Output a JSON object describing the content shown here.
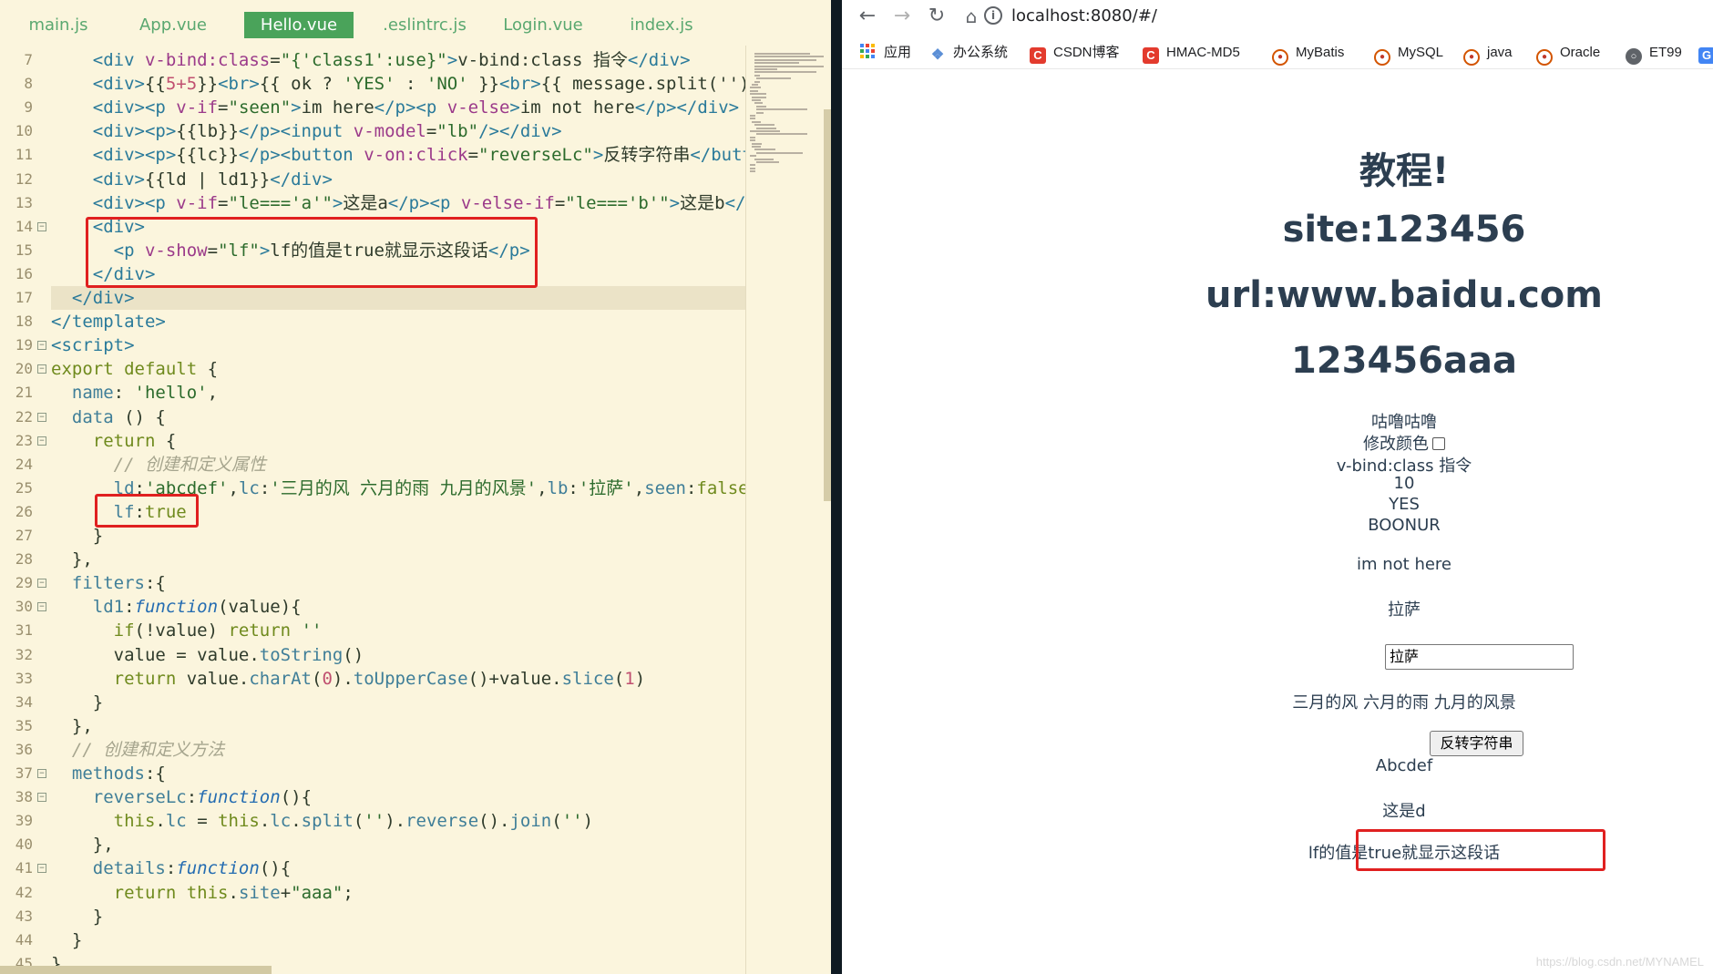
{
  "editor": {
    "tabs": [
      {
        "label": "main.js",
        "active": false
      },
      {
        "label": "App.vue",
        "active": false
      },
      {
        "label": "Hello.vue",
        "active": true
      },
      {
        "label": ".eslintrc.js",
        "active": false
      },
      {
        "label": "Login.vue",
        "active": false
      },
      {
        "label": "index.js",
        "active": false
      }
    ],
    "lines": [
      {
        "n": "7",
        "fold": false,
        "cur": false,
        "tokens": [
          [
            "plain",
            "    "
          ],
          [
            "tag",
            "<div "
          ],
          [
            "attr",
            "v-bind:class"
          ],
          [
            "plain",
            "="
          ],
          [
            "str",
            "\"{'class1':use}\""
          ],
          [
            "tag",
            ">"
          ],
          [
            "plain",
            "v-bind:class 指令"
          ],
          [
            "tag",
            "</div>"
          ]
        ]
      },
      {
        "n": "8",
        "fold": false,
        "cur": false,
        "tokens": [
          [
            "plain",
            "    "
          ],
          [
            "tag",
            "<div>"
          ],
          [
            "plain",
            "{{"
          ],
          [
            "num",
            "5+5"
          ],
          [
            "plain",
            "}}"
          ],
          [
            "tag",
            "<br>"
          ],
          [
            "plain",
            "{{ ok ? "
          ],
          [
            "str",
            "'YES'"
          ],
          [
            "plain",
            " : "
          ],
          [
            "str",
            "'NO'"
          ],
          [
            "plain",
            " }}"
          ],
          [
            "tag",
            "<br>"
          ],
          [
            "plain",
            "{{ message.split(''"
          ],
          [
            "plain",
            ").reverse()"
          ]
        ]
      },
      {
        "n": "9",
        "fold": false,
        "cur": false,
        "tokens": [
          [
            "plain",
            "    "
          ],
          [
            "tag",
            "<div><p "
          ],
          [
            "attr",
            "v-if"
          ],
          [
            "plain",
            "="
          ],
          [
            "str",
            "\"seen\""
          ],
          [
            "tag",
            ">"
          ],
          [
            "plain",
            "im here"
          ],
          [
            "tag",
            "</p><p "
          ],
          [
            "attr",
            "v-else"
          ],
          [
            "tag",
            ">"
          ],
          [
            "plain",
            "im not here"
          ],
          [
            "tag",
            "</p></div>"
          ]
        ]
      },
      {
        "n": "10",
        "fold": false,
        "cur": false,
        "tokens": [
          [
            "plain",
            "    "
          ],
          [
            "tag",
            "<div><p>"
          ],
          [
            "plain",
            "{{lb}}"
          ],
          [
            "tag",
            "</p><input "
          ],
          [
            "attr",
            "v-model"
          ],
          [
            "plain",
            "="
          ],
          [
            "str",
            "\"lb\""
          ],
          [
            "tag",
            "/></div>"
          ]
        ]
      },
      {
        "n": "11",
        "fold": false,
        "cur": false,
        "tokens": [
          [
            "plain",
            "    "
          ],
          [
            "tag",
            "<div><p>"
          ],
          [
            "plain",
            "{{lc}}"
          ],
          [
            "tag",
            "</p><button "
          ],
          [
            "attr",
            "v-on:click"
          ],
          [
            "plain",
            "="
          ],
          [
            "str",
            "\"reverseLc\""
          ],
          [
            "tag",
            ">"
          ],
          [
            "plain",
            "反转字符串"
          ],
          [
            "tag",
            "</button></div>"
          ]
        ]
      },
      {
        "n": "12",
        "fold": false,
        "cur": false,
        "tokens": [
          [
            "plain",
            "    "
          ],
          [
            "tag",
            "<div>"
          ],
          [
            "plain",
            "{{ld | ld1}}"
          ],
          [
            "tag",
            "</div>"
          ]
        ]
      },
      {
        "n": "13",
        "fold": false,
        "cur": false,
        "tokens": [
          [
            "plain",
            "    "
          ],
          [
            "tag",
            "<div><p "
          ],
          [
            "attr",
            "v-if"
          ],
          [
            "plain",
            "="
          ],
          [
            "str",
            "\"le==='a'\""
          ],
          [
            "tag",
            ">"
          ],
          [
            "plain",
            "这是a"
          ],
          [
            "tag",
            "</p><p "
          ],
          [
            "attr",
            "v-else-if"
          ],
          [
            "plain",
            "="
          ],
          [
            "str",
            "\"le==='b'\""
          ],
          [
            "tag",
            ">"
          ],
          [
            "plain",
            "这是b"
          ],
          [
            "tag",
            "</p>"
          ]
        ]
      },
      {
        "n": "14",
        "fold": true,
        "cur": false,
        "tokens": [
          [
            "plain",
            "    "
          ],
          [
            "tag",
            "<div>"
          ]
        ]
      },
      {
        "n": "15",
        "fold": false,
        "cur": false,
        "tokens": [
          [
            "plain",
            "      "
          ],
          [
            "tag",
            "<p "
          ],
          [
            "attr",
            "v-show"
          ],
          [
            "plain",
            "="
          ],
          [
            "str",
            "\"lf\""
          ],
          [
            "tag",
            ">"
          ],
          [
            "plain",
            "lf的值是true就显示这段话"
          ],
          [
            "tag",
            "</p>"
          ]
        ]
      },
      {
        "n": "16",
        "fold": false,
        "cur": false,
        "tokens": [
          [
            "plain",
            "    "
          ],
          [
            "tag",
            "</div>"
          ]
        ]
      },
      {
        "n": "17",
        "fold": false,
        "cur": true,
        "tokens": [
          [
            "plain",
            "  "
          ],
          [
            "tag",
            "</div>"
          ]
        ]
      },
      {
        "n": "18",
        "fold": false,
        "cur": false,
        "tokens": [
          [
            "tag",
            "</template>"
          ]
        ]
      },
      {
        "n": "19",
        "fold": true,
        "cur": false,
        "tokens": [
          [
            "tag",
            "<script>"
          ]
        ]
      },
      {
        "n": "20",
        "fold": true,
        "cur": false,
        "tokens": [
          [
            "kw",
            "export default"
          ],
          [
            "plain",
            " {"
          ]
        ]
      },
      {
        "n": "21",
        "fold": false,
        "cur": false,
        "tokens": [
          [
            "plain",
            "  "
          ],
          [
            "prop",
            "name"
          ],
          [
            "plain",
            ": "
          ],
          [
            "str",
            "'hello'"
          ],
          [
            "plain",
            ","
          ]
        ]
      },
      {
        "n": "22",
        "fold": true,
        "cur": false,
        "tokens": [
          [
            "plain",
            "  "
          ],
          [
            "prop",
            "data"
          ],
          [
            "plain",
            " () {"
          ]
        ]
      },
      {
        "n": "23",
        "fold": true,
        "cur": false,
        "tokens": [
          [
            "plain",
            "    "
          ],
          [
            "kw",
            "return"
          ],
          [
            "plain",
            " {"
          ]
        ]
      },
      {
        "n": "24",
        "fold": false,
        "cur": false,
        "tokens": [
          [
            "plain",
            "      "
          ],
          [
            "cmt",
            "// 创建和定义属性"
          ]
        ]
      },
      {
        "n": "25",
        "fold": false,
        "cur": false,
        "tokens": [
          [
            "plain",
            "      "
          ],
          [
            "prop",
            "ld"
          ],
          [
            "plain",
            ":"
          ],
          [
            "str",
            "'abcdef'"
          ],
          [
            "plain",
            ","
          ],
          [
            "prop",
            "lc"
          ],
          [
            "plain",
            ":"
          ],
          [
            "str",
            "'三月的风 六月的雨 九月的风景'"
          ],
          [
            "plain",
            ","
          ],
          [
            "prop",
            "lb"
          ],
          [
            "plain",
            ":"
          ],
          [
            "str",
            "'拉萨'"
          ],
          [
            "plain",
            ","
          ],
          [
            "prop",
            "seen"
          ],
          [
            "plain",
            ":"
          ],
          [
            "kw",
            "false"
          ]
        ]
      },
      {
        "n": "26",
        "fold": false,
        "cur": false,
        "tokens": [
          [
            "plain",
            "      "
          ],
          [
            "prop",
            "lf"
          ],
          [
            "plain",
            ":"
          ],
          [
            "kw",
            "true"
          ]
        ]
      },
      {
        "n": "27",
        "fold": false,
        "cur": false,
        "tokens": [
          [
            "plain",
            "    }"
          ]
        ]
      },
      {
        "n": "28",
        "fold": false,
        "cur": false,
        "tokens": [
          [
            "plain",
            "  },"
          ]
        ]
      },
      {
        "n": "29",
        "fold": true,
        "cur": false,
        "tokens": [
          [
            "plain",
            "  "
          ],
          [
            "prop",
            "filters"
          ],
          [
            "plain",
            ":{"
          ]
        ]
      },
      {
        "n": "30",
        "fold": true,
        "cur": false,
        "tokens": [
          [
            "plain",
            "    "
          ],
          [
            "prop",
            "ld1"
          ],
          [
            "plain",
            ":"
          ],
          [
            "fn",
            "function"
          ],
          [
            "plain",
            "(value){"
          ]
        ]
      },
      {
        "n": "31",
        "fold": false,
        "cur": false,
        "tokens": [
          [
            "plain",
            "      "
          ],
          [
            "kw",
            "if"
          ],
          [
            "plain",
            "(!value) "
          ],
          [
            "kw",
            "return"
          ],
          [
            "plain",
            " "
          ],
          [
            "str",
            "''"
          ]
        ]
      },
      {
        "n": "32",
        "fold": false,
        "cur": false,
        "tokens": [
          [
            "plain",
            "      value = value."
          ],
          [
            "prop",
            "toString"
          ],
          [
            "plain",
            "()"
          ]
        ]
      },
      {
        "n": "33",
        "fold": false,
        "cur": false,
        "tokens": [
          [
            "plain",
            "      "
          ],
          [
            "kw",
            "return"
          ],
          [
            "plain",
            " value."
          ],
          [
            "prop",
            "charAt"
          ],
          [
            "plain",
            "("
          ],
          [
            "num",
            "0"
          ],
          [
            "plain",
            ")."
          ],
          [
            "prop",
            "toUpperCase"
          ],
          [
            "plain",
            "()+value."
          ],
          [
            "prop",
            "slice"
          ],
          [
            "plain",
            "("
          ],
          [
            "num",
            "1"
          ],
          [
            "plain",
            ")"
          ]
        ]
      },
      {
        "n": "34",
        "fold": false,
        "cur": false,
        "tokens": [
          [
            "plain",
            "    }"
          ]
        ]
      },
      {
        "n": "35",
        "fold": false,
        "cur": false,
        "tokens": [
          [
            "plain",
            "  },"
          ]
        ]
      },
      {
        "n": "36",
        "fold": false,
        "cur": false,
        "tokens": [
          [
            "plain",
            "  "
          ],
          [
            "cmt",
            "// 创建和定义方法"
          ]
        ]
      },
      {
        "n": "37",
        "fold": true,
        "cur": false,
        "tokens": [
          [
            "plain",
            "  "
          ],
          [
            "prop",
            "methods"
          ],
          [
            "plain",
            ":{"
          ]
        ]
      },
      {
        "n": "38",
        "fold": true,
        "cur": false,
        "tokens": [
          [
            "plain",
            "    "
          ],
          [
            "prop",
            "reverseLc"
          ],
          [
            "plain",
            ":"
          ],
          [
            "fn",
            "function"
          ],
          [
            "plain",
            "(){"
          ]
        ]
      },
      {
        "n": "39",
        "fold": false,
        "cur": false,
        "tokens": [
          [
            "plain",
            "      "
          ],
          [
            "kw",
            "this"
          ],
          [
            "plain",
            "."
          ],
          [
            "prop",
            "lc"
          ],
          [
            "plain",
            " = "
          ],
          [
            "kw",
            "this"
          ],
          [
            "plain",
            "."
          ],
          [
            "prop",
            "lc"
          ],
          [
            "plain",
            "."
          ],
          [
            "prop",
            "split"
          ],
          [
            "plain",
            "("
          ],
          [
            "str",
            "''"
          ],
          [
            "plain",
            ")."
          ],
          [
            "prop",
            "reverse"
          ],
          [
            "plain",
            "()."
          ],
          [
            "prop",
            "join"
          ],
          [
            "plain",
            "("
          ],
          [
            "str",
            "''"
          ],
          [
            "plain",
            ")"
          ]
        ]
      },
      {
        "n": "40",
        "fold": false,
        "cur": false,
        "tokens": [
          [
            "plain",
            "    },"
          ]
        ]
      },
      {
        "n": "41",
        "fold": true,
        "cur": false,
        "tokens": [
          [
            "plain",
            "    "
          ],
          [
            "prop",
            "details"
          ],
          [
            "plain",
            ":"
          ],
          [
            "fn",
            "function"
          ],
          [
            "plain",
            "(){"
          ]
        ]
      },
      {
        "n": "42",
        "fold": false,
        "cur": false,
        "tokens": [
          [
            "plain",
            "      "
          ],
          [
            "kw",
            "return"
          ],
          [
            "plain",
            " "
          ],
          [
            "kw",
            "this"
          ],
          [
            "plain",
            "."
          ],
          [
            "prop",
            "site"
          ],
          [
            "plain",
            "+"
          ],
          [
            "str",
            "\"aaa\""
          ],
          [
            "plain",
            ";"
          ]
        ]
      },
      {
        "n": "43",
        "fold": false,
        "cur": false,
        "tokens": [
          [
            "plain",
            "    }"
          ]
        ]
      },
      {
        "n": "44",
        "fold": false,
        "cur": false,
        "tokens": [
          [
            "plain",
            "  }"
          ]
        ]
      },
      {
        "n": "45",
        "fold": false,
        "cur": false,
        "tokens": [
          [
            "plain",
            "}"
          ]
        ]
      }
    ]
  },
  "browser": {
    "url": "localhost:8080/#/",
    "nav_icons": [
      "back-arrow-icon",
      "forward-arrow-icon",
      "reload-icon",
      "home-icon"
    ],
    "bookmarks": [
      {
        "label": "应用",
        "icon": "apps-grid-icon"
      },
      {
        "label": "办公系统",
        "icon": "office-system-icon"
      },
      {
        "label": "CSDN博客",
        "icon": "csdn-icon"
      },
      {
        "label": "HMAC-MD5",
        "icon": "csdn-icon"
      },
      {
        "label": "MyBatis",
        "icon": "bookmark-badge-icon"
      },
      {
        "label": "MySQL",
        "icon": "bookmark-badge-icon"
      },
      {
        "label": "java",
        "icon": "bookmark-badge-icon"
      },
      {
        "label": "Oracle",
        "icon": "bookmark-badge-icon"
      },
      {
        "label": "ET99",
        "icon": "globe-icon"
      },
      {
        "label": "",
        "icon": "translate-icon"
      }
    ],
    "page": {
      "heading": "教程!",
      "site": "site:123456",
      "url_line": "url:www.baidu.com",
      "details": "123456aaa",
      "gulu": "咕噜咕噜",
      "change_color_label": "修改颜色",
      "change_color_checked": false,
      "vbind_line": "v-bind:class 指令",
      "sum": "10",
      "ok_text": "YES",
      "message_reversed": "BOONUR",
      "seen_text": "im not here",
      "lb_text": "拉萨",
      "lb_input_value": "拉萨",
      "lc_text": "三月的风 六月的雨 九月的风景",
      "reverse_button": "反转字符串",
      "ld_filtered": "Abcdef",
      "le_text": "这是d",
      "lf_text": "lf的值是true就显示这段话"
    },
    "watermark": "https://blog.csdn.net/MYNAMEL"
  },
  "colors": {
    "editor_bg": "#fbf5dd",
    "active_tab": "#4aa35a",
    "highlight_box": "#e02020",
    "page_text": "#2c3e50"
  }
}
